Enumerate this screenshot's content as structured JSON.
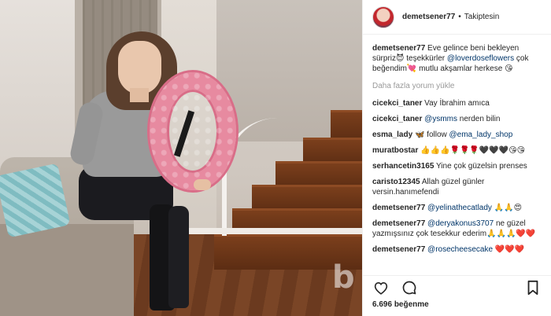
{
  "photo": {
    "watermark": "b"
  },
  "header": {
    "username": "demetsener77",
    "separator": "•",
    "follow_status": "Takiptesin"
  },
  "caption": {
    "username": "demetsener77",
    "text_1": "Eve gelince beni bekleyen sürpriz",
    "emoji_1": "😈",
    "text_2": "teşekkürler",
    "mention": "@loverdoseflowers",
    "text_3": "çok beğendim",
    "emoji_2": "💘",
    "text_4": "mutlu akşamlar herkese",
    "emoji_3": "😘"
  },
  "load_more": "Daha fazla yorum yükle",
  "comments": [
    {
      "user": "cicekci_taner",
      "pre": "Vay İbrahim amıca",
      "mention": "",
      "post": ""
    },
    {
      "user": "cicekci_taner",
      "pre": "",
      "mention": "@ysmms",
      "post": "nerden bilin"
    },
    {
      "user": "esma_lady",
      "pre": "🦋 follow",
      "mention": "@ema_lady_shop",
      "post": ""
    },
    {
      "user": "muratbostar",
      "pre": "👍👍👍🌹🌹🌹🖤🖤🖤😘😘",
      "mention": "",
      "post": ""
    },
    {
      "user": "serhancetin3165",
      "pre": "Yine çok güzelsin prenses",
      "mention": "",
      "post": ""
    },
    {
      "user": "caristo12345",
      "pre": "Allah güzel günler versin.hanımefendi",
      "mention": "",
      "post": ""
    },
    {
      "user": "demetsener77",
      "pre": "",
      "mention": "@yelinathecatlady",
      "post": "🙏🙏😍"
    },
    {
      "user": "demetsener77",
      "pre": "",
      "mention": "@deryakonus3707",
      "post": "ne güzel yazmışsınız çok tesekkur ederim🙏🙏🙏❤️❤️"
    },
    {
      "user": "demetsener77",
      "pre": "",
      "mention": "@rosecheesecake",
      "post": "❤️❤️❤️"
    }
  ],
  "likes": {
    "count": "6.696",
    "label": "beğenme"
  },
  "colors": {
    "link": "#003569",
    "text": "#262626",
    "muted": "#999999",
    "border": "#efefef"
  }
}
